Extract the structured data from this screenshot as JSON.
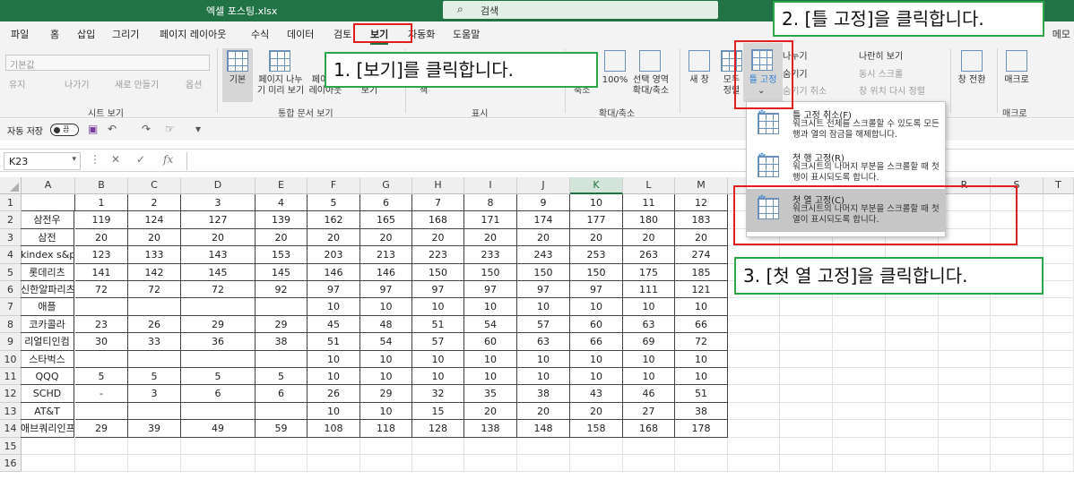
{
  "titlebar": {
    "filename": "엑셀 포스팅.xlsx",
    "search_placeholder": "검색"
  },
  "menu": {
    "tabs": [
      "파일",
      "홈",
      "삽입",
      "그리기",
      "페이지 레이아웃",
      "수식",
      "데이터",
      "검토",
      "보기",
      "자동화",
      "도움말"
    ],
    "memo": "메모"
  },
  "ribbon": {
    "sheet_view_select": "기본값",
    "sheet_view_btns": [
      "유지",
      "나가기",
      "새로 만들기",
      "옵션"
    ],
    "group_sheet_view": "시트 보기",
    "view_btn1": "기본",
    "view_btn2_l1": "페이지 나누",
    "view_btn2_l2": "기 미리 보기",
    "view_btn3_l1": "페이",
    "view_btn3_l2": "레이아웃",
    "view_btn4": "보기",
    "group_workbook_views": "통합 문서 보기",
    "show_fragment": "책",
    "group_show": "표시",
    "zoom_label": "축소",
    "zoom_100": "100%",
    "zoom_sel_l1": "선택 영역",
    "zoom_sel_l2": "확대/축소",
    "group_zoom": "확대/축소",
    "new_window": "새 창",
    "arrange_l1": "모두",
    "arrange_l2": "정렬",
    "freeze_l1": "틀 고정",
    "split": "나누기",
    "hide": "숨기기",
    "unhide": "숨기기 취소",
    "side_by_side": "나란히 보기",
    "sync_scroll": "동시 스크롤",
    "reset_pos": "창 위치 다시 정렬",
    "switch_windows": "창 전환",
    "macros": "매크로",
    "group_macro": "매크로"
  },
  "qat": {
    "autosave": "자동 저장",
    "toggle": "끔"
  },
  "formula": {
    "namebox": "K23",
    "fx": "fx"
  },
  "columns": [
    "A",
    "B",
    "C",
    "D",
    "E",
    "F",
    "G",
    "H",
    "I",
    "J",
    "K",
    "L",
    "M",
    "N",
    "O",
    "P",
    "Q",
    "R",
    "S",
    "T"
  ],
  "rows": [
    "1",
    "2",
    "3",
    "4",
    "5",
    "6",
    "7",
    "8",
    "9",
    "10",
    "11",
    "12",
    "13",
    "14",
    "15",
    "16"
  ],
  "sheet": [
    [
      "",
      "1",
      "2",
      "3",
      "4",
      "5",
      "6",
      "7",
      "8",
      "9",
      "10",
      "11",
      "12"
    ],
    [
      "삼전우",
      "119",
      "124",
      "127",
      "139",
      "162",
      "165",
      "168",
      "171",
      "174",
      "177",
      "180",
      "183"
    ],
    [
      "삼전",
      "20",
      "20",
      "20",
      "20",
      "20",
      "20",
      "20",
      "20",
      "20",
      "20",
      "20",
      "20"
    ],
    [
      "kindex s&p",
      "123",
      "133",
      "143",
      "153",
      "203",
      "213",
      "223",
      "233",
      "243",
      "253",
      "263",
      "274"
    ],
    [
      "롯데리츠",
      "141",
      "142",
      "145",
      "145",
      "146",
      "146",
      "150",
      "150",
      "150",
      "150",
      "175",
      "185"
    ],
    [
      "신한알파리츠",
      "72",
      "72",
      "72",
      "92",
      "97",
      "97",
      "97",
      "97",
      "97",
      "97",
      "111",
      "121"
    ],
    [
      "애플",
      "",
      "",
      "",
      "",
      "10",
      "10",
      "10",
      "10",
      "10",
      "10",
      "10",
      "10"
    ],
    [
      "코카콜라",
      "23",
      "26",
      "29",
      "29",
      "45",
      "48",
      "51",
      "54",
      "57",
      "60",
      "63",
      "66"
    ],
    [
      "리얼티인컴",
      "30",
      "33",
      "36",
      "38",
      "51",
      "54",
      "57",
      "60",
      "63",
      "66",
      "69",
      "72"
    ],
    [
      "스타벅스",
      "",
      "",
      "",
      "",
      "10",
      "10",
      "10",
      "10",
      "10",
      "10",
      "10",
      "10"
    ],
    [
      "QQQ",
      "5",
      "5",
      "5",
      "5",
      "10",
      "10",
      "10",
      "10",
      "10",
      "10",
      "10",
      "10"
    ],
    [
      "SCHD",
      "-",
      "3",
      "6",
      "6",
      "26",
      "29",
      "32",
      "35",
      "38",
      "43",
      "46",
      "51"
    ],
    [
      "AT&T",
      "",
      "",
      "",
      "",
      "10",
      "10",
      "15",
      "20",
      "20",
      "20",
      "27",
      "38"
    ],
    [
      "애브쿼리인프라",
      "29",
      "39",
      "49",
      "59",
      "108",
      "118",
      "128",
      "138",
      "148",
      "158",
      "168",
      "178"
    ]
  ],
  "dropdown": [
    {
      "title": "틀 고정 취소(F)",
      "desc": "워크시트 전체를 스크롤할 수 있도록 모든 행과 열의 잠금을 해제합니다."
    },
    {
      "title": "첫 행 고정(R)",
      "desc": "워크시트의 나머지 부분을 스크롤할 때 첫 행이 표시되도록 합니다."
    },
    {
      "title": "첫 열 고정(C)",
      "desc": "워크시트의 나머지 부분을 스크롤할 때 첫 열이 표시되도록 합니다."
    }
  ],
  "callouts": {
    "step1": "1. [보기]를 클릭합니다.",
    "step2": "2. [틀 고정]을 클릭합니다.",
    "step3": "3. [첫 열 고정]을 클릭합니다."
  },
  "colors": {
    "excel_green": "#217346",
    "callout_border": "#2aa74a",
    "highlight_red": "#e02020"
  }
}
